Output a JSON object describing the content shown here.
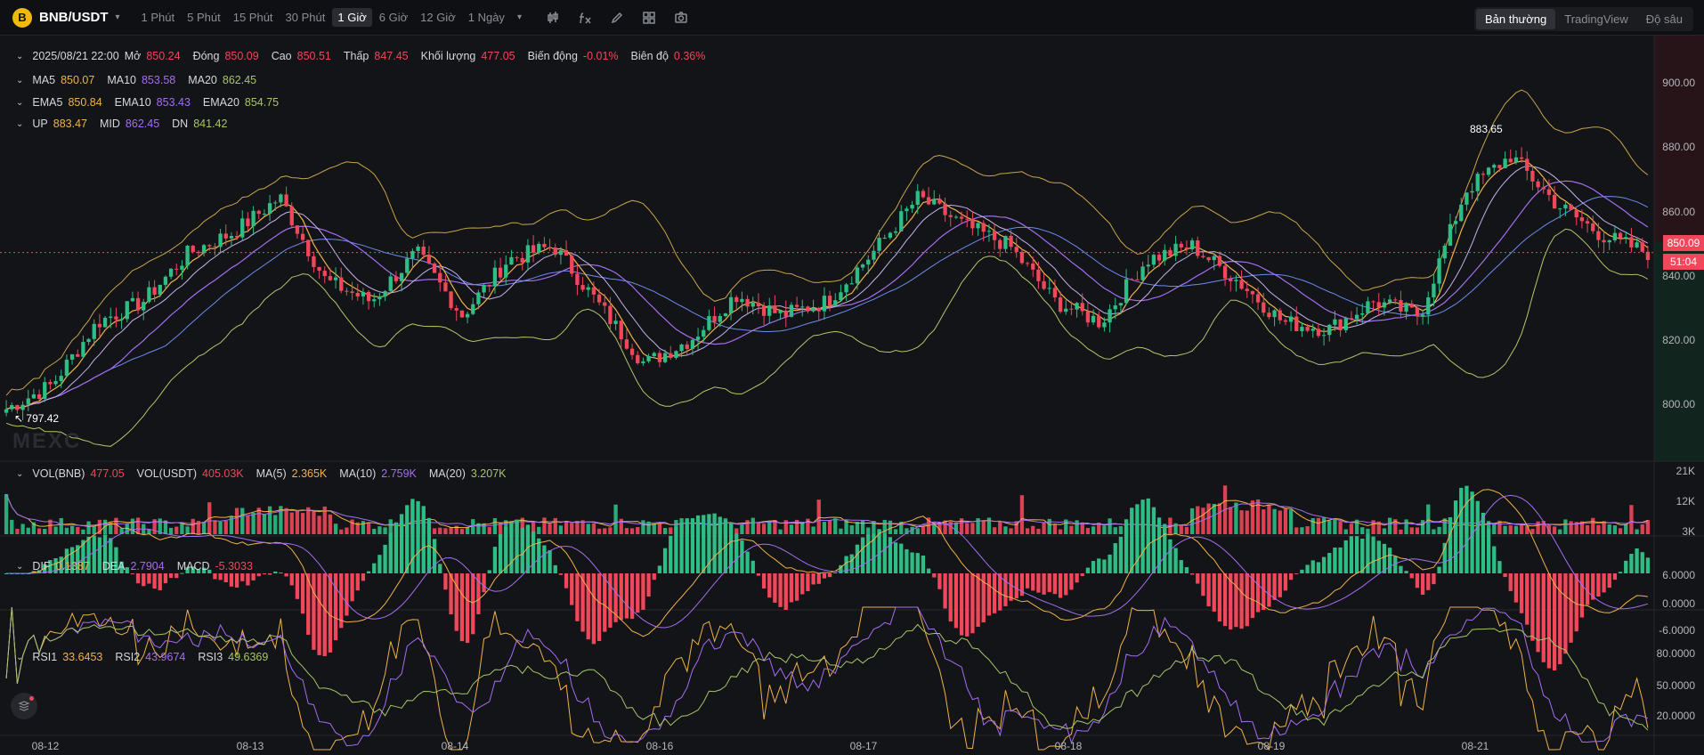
{
  "toolbar": {
    "coin_letter": "B",
    "pair": "BNB/USDT",
    "intervals": [
      "1 Phút",
      "5 Phút",
      "15 Phút",
      "30 Phút",
      "1 Giờ",
      "6 Giờ",
      "12 Giờ",
      "1 Ngày"
    ],
    "active_interval": "1 Giờ",
    "view_tabs": [
      "Bản thường",
      "TradingView",
      "Độ sâu"
    ],
    "active_view": "Bản thường",
    "tool_icons": [
      "candle-type-icon",
      "indicator-fx-icon",
      "draw-pencil-icon",
      "layout-grid-icon",
      "camera-icon"
    ]
  },
  "ohlc": {
    "date": "2025/08/21 22:00",
    "open_label": "Mở",
    "open": "850.24",
    "close_label": "Đóng",
    "close": "850.09",
    "high_label": "Cao",
    "high": "850.51",
    "low_label": "Thấp",
    "low": "847.45",
    "vol_label": "Khối lượng",
    "vol": "477.05",
    "change_label": "Biến động",
    "change": "-0.01%",
    "amp_label": "Biên độ",
    "amp": "0.36%"
  },
  "ma": {
    "ma5_label": "MA5",
    "ma5": "850.07",
    "ma10_label": "MA10",
    "ma10": "853.58",
    "ma20_label": "MA20",
    "ma20": "862.45"
  },
  "ema": {
    "ema5_label": "EMA5",
    "ema5": "850.84",
    "ema10_label": "EMA10",
    "ema10": "853.43",
    "ema20_label": "EMA20",
    "ema20": "854.75"
  },
  "boll": {
    "up_label": "UP",
    "up": "883.47",
    "mid_label": "MID",
    "mid": "862.45",
    "dn_label": "DN",
    "dn": "841.42"
  },
  "volume": {
    "vol_bnb_label": "VOL(BNB)",
    "vol_bnb": "477.05",
    "vol_usdt_label": "VOL(USDT)",
    "vol_usdt": "405.03K",
    "ma5_label": "MA(5)",
    "ma5": "2.365K",
    "ma10_label": "MA(10)",
    "ma10": "2.759K",
    "ma20_label": "MA(20)",
    "ma20": "3.207K",
    "axis": [
      "21K",
      "12K",
      "3K"
    ]
  },
  "macd": {
    "dif_label": "DIF",
    "dif": "0.1387",
    "dea_label": "DEA",
    "dea": "2.7904",
    "macd_label": "MACD",
    "macd": "-5.3033",
    "axis": [
      "6.0000",
      "0.0000",
      "-6.0000"
    ]
  },
  "rsi": {
    "rsi1_label": "RSI1",
    "rsi1": "33.6453",
    "rsi2_label": "RSI2",
    "rsi2": "43.9674",
    "rsi3_label": "RSI3",
    "rsi3": "49.6369",
    "axis": [
      "80.0000",
      "50.0000",
      "20.0000"
    ]
  },
  "price_axis": [
    "900.00",
    "880.00",
    "860.00",
    "840.00",
    "820.00",
    "800.00"
  ],
  "current_price": "850.09",
  "countdown": "51:04",
  "high_marker": "883.65",
  "low_marker": "797.42",
  "watermark": "MEXC",
  "dates": [
    "08-12",
    "08-13",
    "08-14",
    "08-16",
    "08-17",
    "08-18",
    "08-19",
    "08-21"
  ],
  "colors": {
    "up": "#2ebd85",
    "down": "#f0475a",
    "ma5": "#f0b24a",
    "ma10": "#a46ef0",
    "ma20": "#a8c46a",
    "bg": "#131417"
  },
  "chart_data": {
    "type": "candlestick",
    "title": "BNB/USDT",
    "x": [
      "08-12",
      "08-13",
      "08-14",
      "08-16",
      "08-17",
      "08-18",
      "08-19",
      "08-21"
    ],
    "price_close_path": [
      805,
      812,
      830,
      836,
      850,
      856,
      866,
      842,
      836,
      850,
      832,
      848,
      852,
      835,
      818,
      825,
      838,
      832,
      836,
      850,
      866,
      858,
      852,
      836,
      830,
      848,
      852,
      842,
      830,
      828,
      836,
      832,
      868,
      878,
      864,
      855,
      850
    ],
    "ylim": [
      790,
      910
    ],
    "volume_ylim": [
      0,
      21000
    ],
    "macd_ylim": [
      -8,
      8
    ],
    "rsi_ylim": [
      10,
      90
    ]
  }
}
